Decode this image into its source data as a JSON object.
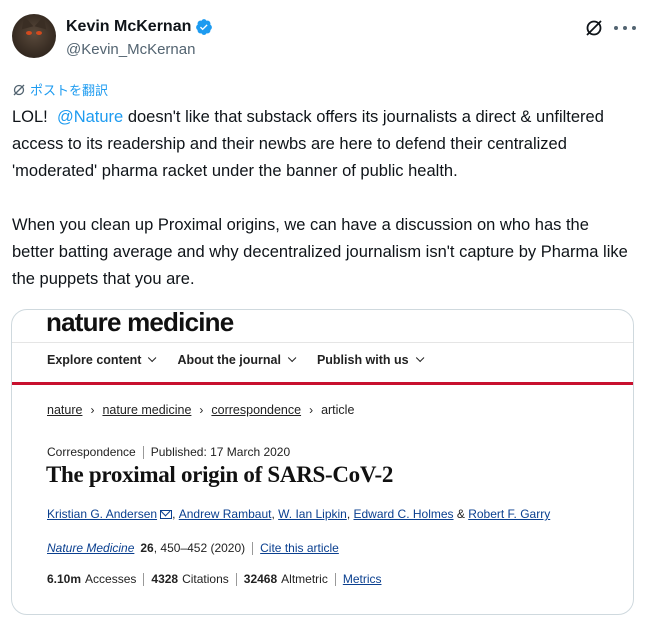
{
  "author": {
    "display_name": "Kevin McKernan",
    "handle": "@Kevin_McKernan"
  },
  "translate_label": "ポストを翻訳",
  "tweet": {
    "line1_prefix": "LOL!",
    "mention": "@Nature",
    "line1_rest": " doesn't like that substack offers its journalists a direct & unfiltered access to its readership and their newbs are here to defend their centralized 'moderated' pharma racket under the banner of public health.",
    "paragraph2": "When you clean up Proximal origins, we can have a discussion on who has the better batting average and why decentralized journalism isn't capture by Pharma like the puppets that you are."
  },
  "card": {
    "logo": "nature medicine",
    "nav": [
      "Explore content",
      "About the journal",
      "Publish with us"
    ],
    "breadcrumbs": [
      "nature",
      "nature medicine",
      "correspondence",
      "article"
    ],
    "type": "Correspondence",
    "published": "Published: 17 March 2020",
    "title": "The proximal origin of SARS-CoV-2",
    "authors": [
      "Kristian G. Andersen",
      "Andrew Rambaut",
      "W. Ian Lipkin",
      "Edward C. Holmes",
      "Robert F. Garry"
    ],
    "journal_name": "Nature Medicine",
    "volume": "26",
    "pages": ", 450–452 (2020)",
    "cite_label": "Cite this article",
    "accesses_value": "6.10m",
    "accesses_label": "Accesses",
    "citations_value": "4328",
    "citations_label": "Citations",
    "altmetric_value": "32468",
    "altmetric_label": "Altmetric",
    "metrics_label": "Metrics"
  },
  "colors": {
    "link_blue": "#1d9bf0",
    "nature_red": "#c8102e",
    "nature_link": "#0a3f8f"
  }
}
